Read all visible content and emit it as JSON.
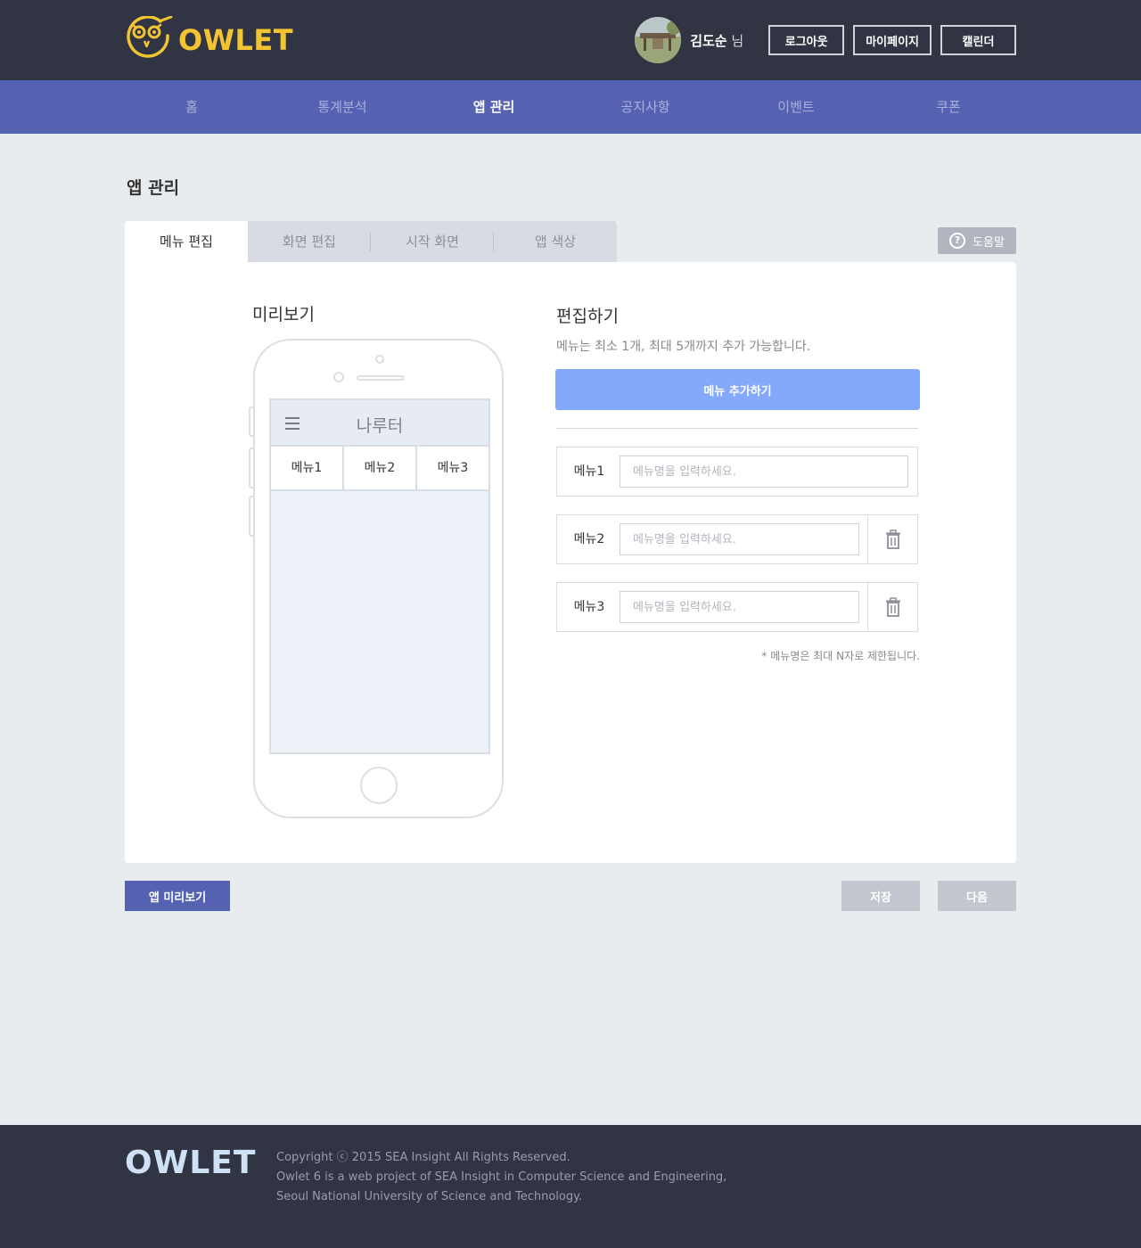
{
  "brand": {
    "name": "OWLET",
    "accent": "#f3c432",
    "nav_color": "#5462b1"
  },
  "user": {
    "name": "김도순",
    "suffix": "님"
  },
  "header_buttons": {
    "logout": "로그아웃",
    "mypage": "마이페이지",
    "calendar": "캘린더"
  },
  "nav": {
    "items": [
      {
        "label": "홈"
      },
      {
        "label": "통계분석"
      },
      {
        "label": "앱 관리"
      },
      {
        "label": "공지사항"
      },
      {
        "label": "이벤트"
      },
      {
        "label": "쿠폰"
      }
    ],
    "active": "앱 관리"
  },
  "page": {
    "title": "앱 관리"
  },
  "tabs": [
    {
      "label": "메뉴 편집"
    },
    {
      "label": "화면 편집"
    },
    {
      "label": "시작 화면"
    },
    {
      "label": "앱 색상"
    }
  ],
  "help": {
    "label": "도움말",
    "icon": "question-icon"
  },
  "preview": {
    "title": "미리보기",
    "app_title": "나루터",
    "menus": [
      "메뉴1",
      "메뉴2",
      "메뉴3"
    ]
  },
  "editor": {
    "title": "편집하기",
    "description": "메뉴는 최소 1개, 최대 5개까지 추가 가능합니다.",
    "add_button": "메뉴 추가하기",
    "rows": [
      {
        "label": "메뉴1",
        "value": "",
        "placeholder": "메뉴명을 입력하세요."
      },
      {
        "label": "메뉴2",
        "value": "",
        "placeholder": "메뉴명을 입력하세요."
      },
      {
        "label": "메뉴3",
        "value": "",
        "placeholder": "메뉴명을 입력하세요."
      }
    ],
    "note": "* 메뉴명은 최대 N자로 제한됩니다."
  },
  "actions": {
    "app_preview": "앱 미리보기",
    "save": "저장",
    "next": "다음"
  },
  "footer": {
    "logo": "OWLET",
    "lines": [
      "Copyright ⓒ 2015 SEA Insight All Rights Reserved.",
      "Owlet 6 is a web project of SEA Insight in Computer Science and Engineering,",
      "Seoul National University of Science and Technology."
    ]
  }
}
